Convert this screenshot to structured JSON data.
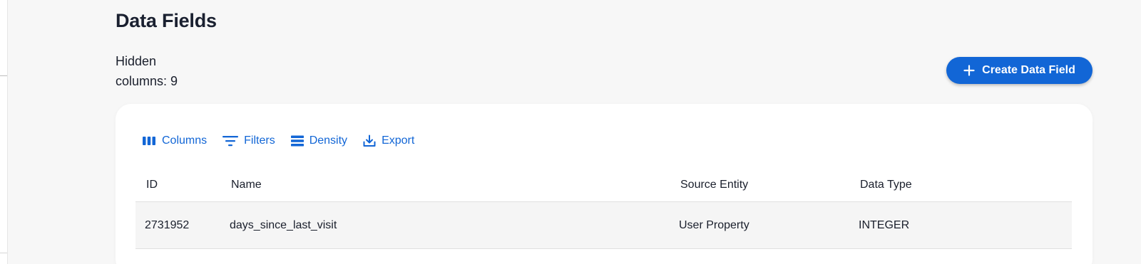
{
  "page": {
    "title": "Data Fields",
    "hidden_columns_line1": "Hidden",
    "hidden_columns_line2": "columns: 9"
  },
  "actions": {
    "create_label": "Create Data Field",
    "create_icon": "plus-icon"
  },
  "toolbar": {
    "items": [
      {
        "label": "Columns",
        "icon": "columns-icon"
      },
      {
        "label": "Filters",
        "icon": "filter-icon"
      },
      {
        "label": "Density",
        "icon": "density-icon"
      },
      {
        "label": "Export",
        "icon": "export-icon"
      }
    ]
  },
  "table": {
    "columns": [
      "ID",
      "Name",
      "Source Entity",
      "Data Type"
    ],
    "rows": [
      {
        "id": "2731952",
        "name": "days_since_last_visit",
        "source_entity": "User Property",
        "data_type": "INTEGER"
      }
    ]
  },
  "colors": {
    "accent": "#1266d6",
    "background": "#f7f7f7",
    "card": "#ffffff",
    "row_highlight": "#f5f5f5"
  }
}
